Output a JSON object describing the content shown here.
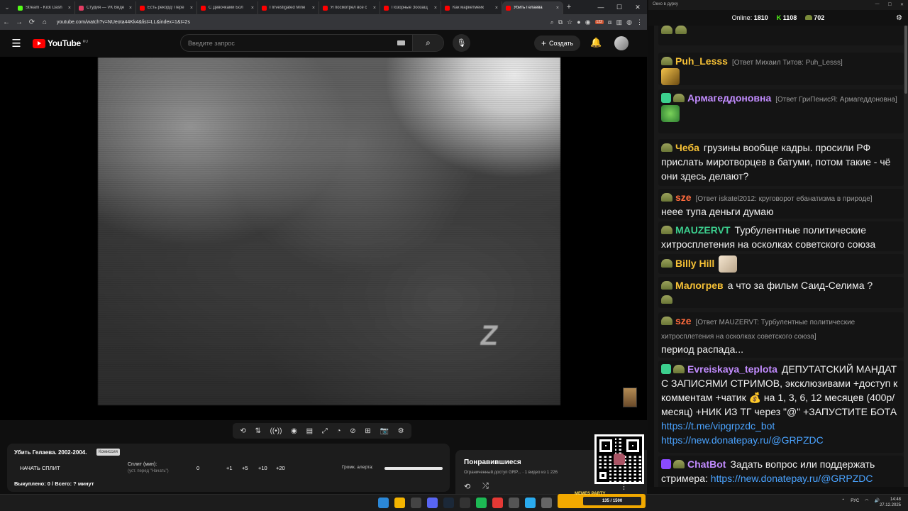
{
  "browser": {
    "tabs": [
      {
        "label": "Stream - Kick Dash",
        "color": "#53fc18"
      },
      {
        "label": "Студия — VK Виде",
        "color": "#e23d63"
      },
      {
        "label": "Есть рекорд! Пере",
        "color": "#ff0000"
      },
      {
        "label": "С Девочками Бол",
        "color": "#ff0000"
      },
      {
        "label": "I Investigated Mine",
        "color": "#ff0000"
      },
      {
        "label": "Я посмотрел все с",
        "color": "#ff0000"
      },
      {
        "label": "Позорные Зоозащ",
        "color": "#ff0000"
      },
      {
        "label": "Как маркетмейк",
        "color": "#ff0000"
      },
      {
        "label": "Убить Гелаева",
        "color": "#ff0000"
      }
    ],
    "url": "youtube.com/watch?v=NUeota44Kk4&list=LL&index=1&t=2s",
    "ext_badge": "122"
  },
  "youtube": {
    "logo_word": "YouTube",
    "logo_region": "RU",
    "search_placeholder": "Введите запрос",
    "create_label": "Создать"
  },
  "split": {
    "title": "Убить Гелаева. 2002-2004.",
    "chip": "Комиссия",
    "start_label": "НАЧАТЬ СПЛИТ",
    "split_label": "Сплит (мин):",
    "split_hint": "(уст. перед \"Начать\")",
    "split_value": "0",
    "increments": [
      "+1",
      "+5",
      "+10",
      "+20"
    ],
    "volume_label": "Громк. алерта:",
    "volume_level": 1.0,
    "status": "Выкуплено: 0 / Всего: ? минут"
  },
  "liked": {
    "title": "Понравившиеся",
    "subtitle": "Ограниченный доступ GRP... · 1 видео из 1 226"
  },
  "chat": {
    "window_title": "Окно в дурку",
    "online_label": "Online:",
    "online": "1810",
    "kick_count": "1108",
    "hat_count": "702",
    "messages": [
      {
        "nick": "Puh_Lesss",
        "color": "#f6c136",
        "reply": "[Ответ Михаил Титов: Puh_Lesss]",
        "text": ""
      },
      {
        "nick": "Армагеддоновна",
        "color": "#c28cff",
        "reply": "[Ответ ГриПенисЯ: Армагеддоновна]",
        "text": ""
      },
      {
        "nick": "Чеба",
        "color": "#f6c136",
        "reply": "",
        "text": "грузины вообще кадры. просили РФ прислать миротворцев в батуми, потом такие - чё они здесь делают?"
      },
      {
        "nick": "sze",
        "color": "#ff6b3d",
        "reply": "[Ответ iskatel2012: круговорот ебанатизма в природе]",
        "text": "неее тупа деньги думаю"
      },
      {
        "nick": "MAUZERVT",
        "color": "#3ccf8e",
        "reply": "",
        "text": "Турбулентные политические хитросплетения на осколках советского союза"
      },
      {
        "nick": "Billy Hill",
        "color": "#f6c136",
        "reply": "",
        "text": ""
      },
      {
        "nick": "Малогрев",
        "color": "#f6c136",
        "reply": "",
        "text": "а что за фильм Саид-Селима  ?"
      },
      {
        "nick": "sze",
        "color": "#ff6b3d",
        "reply": "[Ответ MAUZERVT: Турбулентные политические хитросплетения на осколках советского союза]",
        "text": "период распада..."
      },
      {
        "nick": "Evreiskaya_teplota",
        "color": "#c28cff",
        "reply": "",
        "text": "ДЕПУТАТСКИЙ МАНДАТ С ЗАПИСЯМИ СТРИМОВ, эксклюзивами +доступ к комментам +чатик 💰 на 1, 3, 6, 12 месяцев (400р/месяц) +НИК ИЗ ТГ через \"@\" +ЗАПУСТИТЕ БОТА",
        "link1": "https://t.me/vipgrpzdc_bot",
        "link2": "https://new.donatepay.ru/@GRPZDC"
      },
      {
        "nick": "ChatBot",
        "color": "#c28cff",
        "reply": "",
        "text": "Задать вопрос или поддержать стримера:",
        "link1": "https://new.donatepay.ru/@GRPZDC"
      }
    ]
  },
  "overlay": {
    "memes_label": "MEMES PARTY",
    "memes_value": "135 / 1500"
  },
  "taskbar": {
    "lang": "РУС",
    "time": "14:48",
    "date": "27.12.2025"
  }
}
